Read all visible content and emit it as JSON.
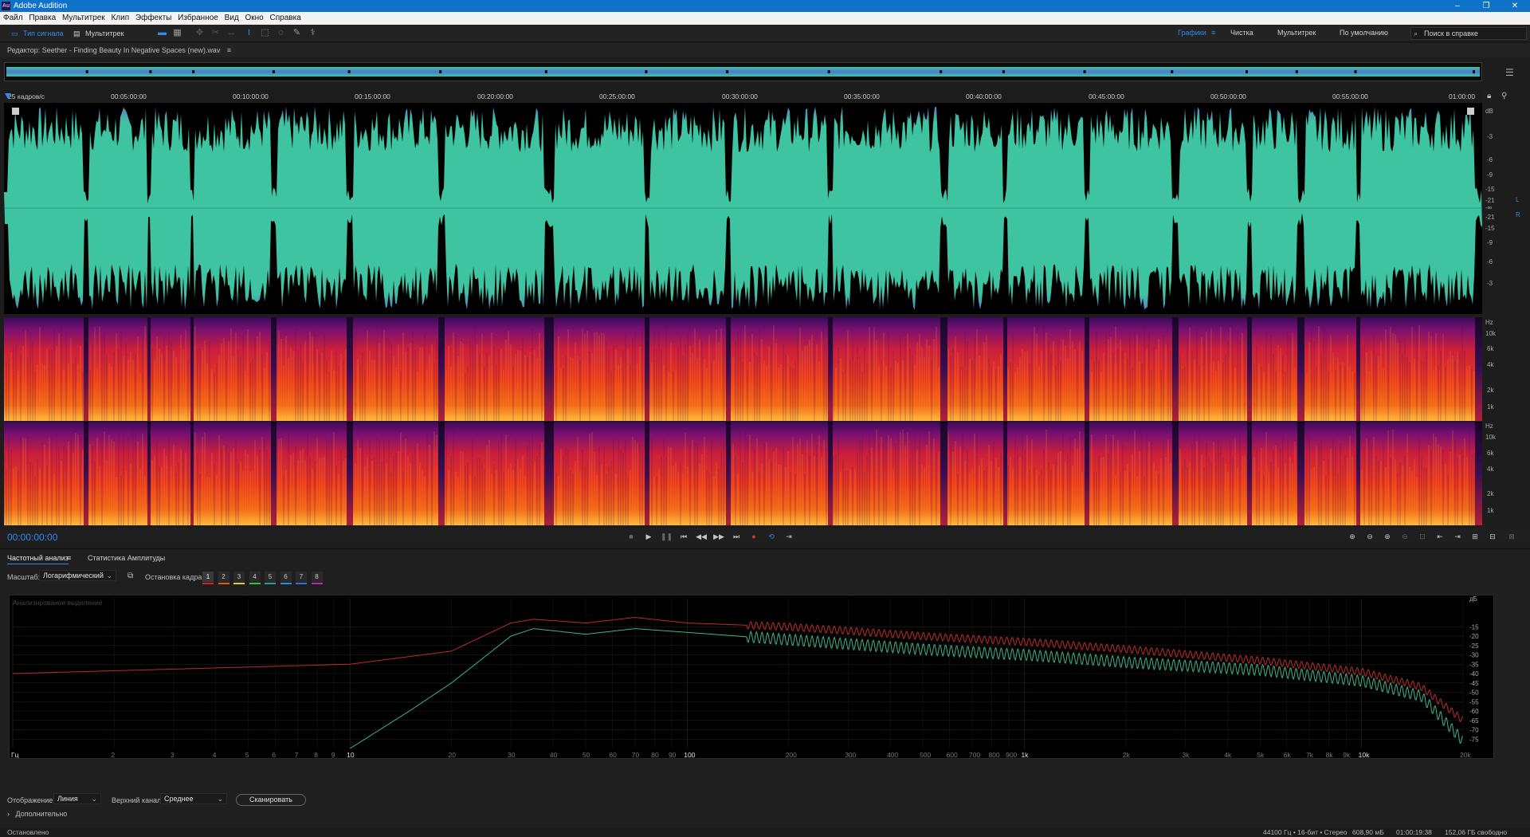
{
  "window": {
    "app_icon": "Au",
    "title": "Adobe Audition"
  },
  "menu": [
    "Файл",
    "Правка",
    "Мультитрек",
    "Клип",
    "Эффекты",
    "Избранное",
    "Вид",
    "Окно",
    "Справка"
  ],
  "toolbar": {
    "view_waveform_label": "Тип сигнала",
    "view_multitrack_label": "Мультитрек",
    "workspaces": [
      "Графики",
      "Чистка",
      "Мультитрек",
      "По умолчанию"
    ],
    "active_workspace": "Графики",
    "search_placeholder": "Поиск в справке"
  },
  "editor": {
    "title": "Редактор: Seether - Finding Beauty In Negative Spaces (new).wav",
    "ruler_unit": "25 кадров/с",
    "ruler_ticks": [
      "00:05:00:00",
      "00:10:00:00",
      "00:15:00:00",
      "00:20:00:00",
      "00:25:00:00",
      "00:30:00:00",
      "00:35:00:00",
      "00:40:00:00",
      "00:45:00:00",
      "00:50:00:00",
      "00:55:00:00",
      "01:00:00"
    ],
    "db_unit": "dB",
    "db_scale": [
      "-3",
      "-6",
      "-9",
      "-15",
      "-21",
      "-∞",
      "-21",
      "-15",
      "-9",
      "-6",
      "-3"
    ],
    "channel_labels": [
      "L",
      "R"
    ],
    "hz_unit": "Hz",
    "hz_scale": [
      "10k",
      "6k",
      "4k",
      "2k",
      "1k"
    ],
    "timecode": "00:00:00:00",
    "colors": {
      "waveform": "#3fc4a2",
      "waveform_edge": "#5a7cc0",
      "background": "#000000",
      "accent": "#2d8ceb"
    }
  },
  "lower_panel": {
    "tabs": [
      "Частотный анализ",
      "Статистика Амплитуды"
    ],
    "scale_label": "Масштаб:",
    "scale_value": "Логарифмический",
    "freeze_label": "Остановка кадра:",
    "freeze_buttons": [
      "1",
      "2",
      "3",
      "4",
      "5",
      "6",
      "7",
      "8"
    ],
    "freeze_colors": [
      "#d82020",
      "#e05a10",
      "#e8d020",
      "#30c030",
      "#20a0a0",
      "#2090e0",
      "#3070e0",
      "#c020c0"
    ],
    "analyzed_label": "Анализированое выделение",
    "display_label": "Отображение:",
    "display_value": "Линия",
    "channel_label": "Верхний канал:",
    "channel_value": "Среднее",
    "scan_button": "Сканировать",
    "more_label": "Дополнительно"
  },
  "chart_data": {
    "type": "line",
    "title": "",
    "xlabel": "Гц",
    "ylabel": "дБ",
    "x_scale": "log",
    "xlim": [
      1,
      20000
    ],
    "ylim": [
      -80,
      0
    ],
    "x_tick_labels": [
      "Гц",
      "2",
      "3",
      "4",
      "5",
      "6",
      "7",
      "8",
      "9",
      "10",
      "20",
      "30",
      "40",
      "50",
      "60",
      "70",
      "80",
      "90",
      "100",
      "200",
      "300",
      "400",
      "500",
      "600",
      "700",
      "800",
      "900",
      "1k",
      "2k",
      "3k",
      "4k",
      "5k",
      "6k",
      "7k",
      "8k",
      "9k",
      "10k",
      "20k"
    ],
    "y_tick_labels": [
      "дБ",
      "-15",
      "-20",
      "-25",
      "-30",
      "-35",
      "-40",
      "-45",
      "-50",
      "-55",
      "-60",
      "-65",
      "-70",
      "-75"
    ],
    "grid": true,
    "series": [
      {
        "color": "#c02a2a",
        "x": [
          1,
          10,
          20,
          30,
          35,
          50,
          70,
          100,
          200,
          500,
          1000,
          2000,
          5000,
          10000,
          15000,
          20000
        ],
        "y": [
          -40,
          -35,
          -28,
          -13,
          -11,
          -13,
          -10,
          -13,
          -15,
          -20,
          -23,
          -27,
          -33,
          -39,
          -47,
          -65
        ]
      },
      {
        "color": "#3fb38a",
        "x": [
          10,
          15,
          20,
          30,
          35,
          50,
          70,
          100,
          200,
          500,
          1000,
          2000,
          5000,
          10000,
          15000,
          20000
        ],
        "y": [
          -80,
          -60,
          -45,
          -20,
          -16,
          -19,
          -16,
          -18,
          -22,
          -27,
          -30,
          -34,
          -38,
          -44,
          -52,
          -76
        ]
      }
    ]
  },
  "status": {
    "state": "Остановлено",
    "format": "44100 Гц • 16-бит • Стерео",
    "size": "608,90 мБ",
    "duration": "01:00:19:38",
    "free": "152,06 ГБ свободно"
  }
}
